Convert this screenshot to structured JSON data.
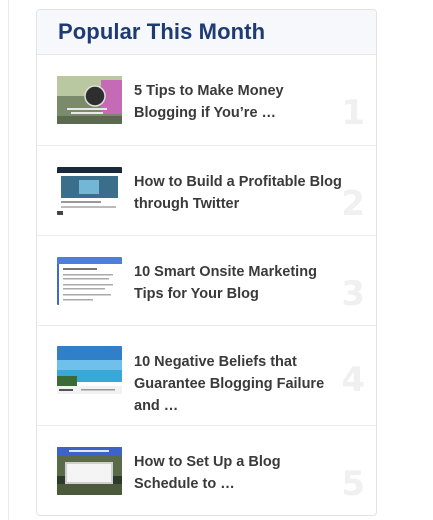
{
  "widget": {
    "title": "Popular This Month",
    "posts": [
      {
        "title": "5 Tips to Make Money Blogging if You’re …",
        "rank": "1",
        "thumb_icon": "blog-money-thumbnail"
      },
      {
        "title": "How to Build a Profitable Blog through Twitter",
        "rank": "2",
        "thumb_icon": "twitter-blog-thumbnail"
      },
      {
        "title": "10 Smart Onsite Marketing Tips for Your Blog",
        "rank": "3",
        "thumb_icon": "onsite-marketing-thumbnail"
      },
      {
        "title": "10 Negative Beliefs that Guarantee Blogging Failure and …",
        "rank": "4",
        "thumb_icon": "negative-beliefs-thumbnail"
      },
      {
        "title": "How to Set Up a Blog Schedule to …",
        "rank": "5",
        "thumb_icon": "blog-schedule-thumbnail"
      }
    ]
  },
  "colors": {
    "title": "#1f3b73",
    "rank": "#f0f0f0",
    "text": "#3a3a3a"
  }
}
